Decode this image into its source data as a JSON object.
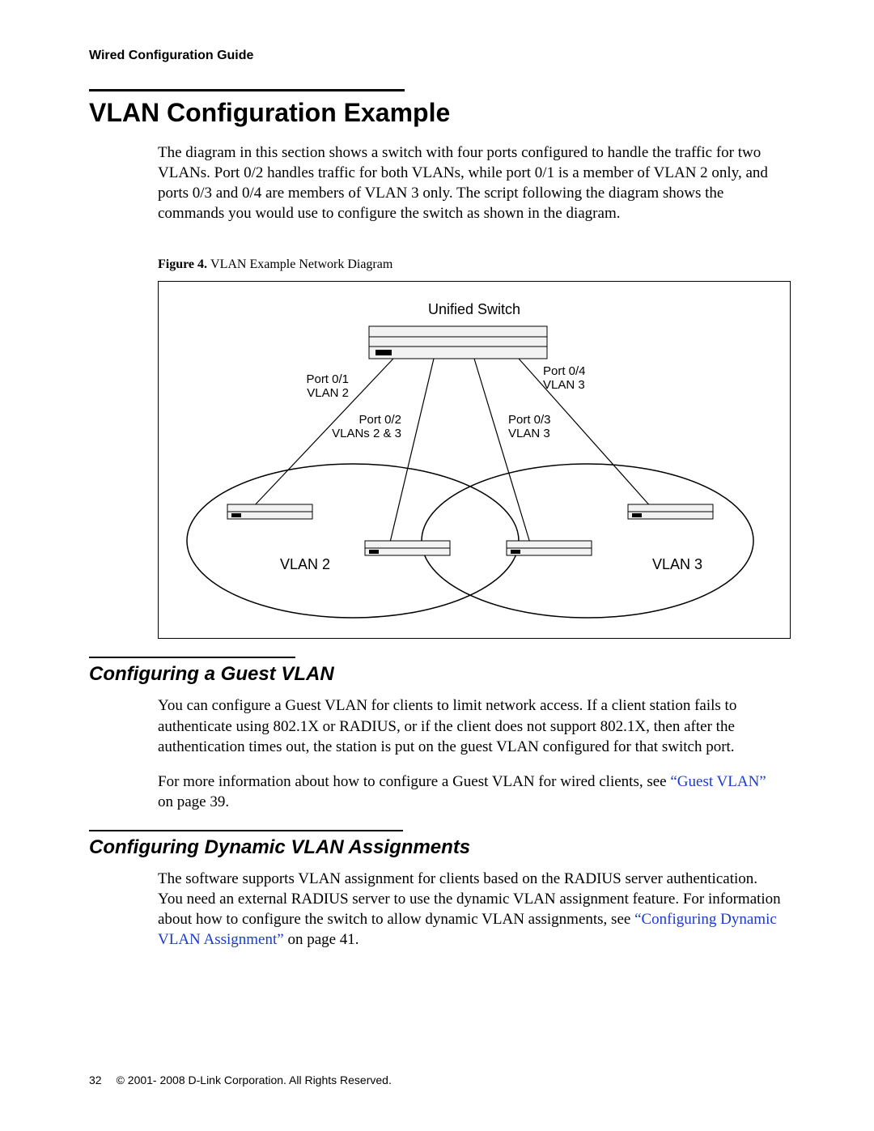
{
  "header": {
    "running_head": "Wired Configuration Guide"
  },
  "section": {
    "title": "VLAN Configuration Example",
    "intro": "The diagram in this section shows a switch with four ports configured to handle the traffic for two VLANs. Port 0/2 handles traffic for both VLANs, while port 0/1 is a member of VLAN 2 only, and ports 0/3 and 0/4 are members of VLAN 3 only. The script following the diagram shows the commands you would use to configure the switch as shown in the diagram."
  },
  "figure": {
    "label": "Figure 4. ",
    "caption": "VLAN Example Network Diagram",
    "top_label": "Unified Switch",
    "port1": {
      "name": "Port 0/1",
      "vlan": "VLAN 2"
    },
    "port2": {
      "name": "Port 0/2",
      "vlan": "VLANs 2 & 3"
    },
    "port3": {
      "name": "Port 0/3",
      "vlan": "VLAN 3"
    },
    "port4": {
      "name": "Port 0/4",
      "vlan": "VLAN 3"
    },
    "vlan_left": "VLAN 2",
    "vlan_right": "VLAN 3"
  },
  "sub1": {
    "title": "Configuring a Guest VLAN",
    "para1": "You can configure a Guest VLAN for clients to limit network access. If a client station fails to authenticate using 802.1X or RADIUS, or if the client does not support 802.1X, then after the authentication times out, the station is put on the guest VLAN configured for that switch port.",
    "para2_a": "For more information about how to configure a Guest VLAN for wired clients, see ",
    "para2_link": "“Guest VLAN”",
    "para2_b": " on page 39."
  },
  "sub2": {
    "title": "Configuring Dynamic VLAN Assignments",
    "para_a": "The software supports VLAN assignment for clients based on the RADIUS server authentication. You need an external RADIUS server to use the dynamic VLAN assignment feature. For information about how to configure the switch to allow dynamic VLAN assignments, see ",
    "para_link": "“Configuring Dynamic VLAN Assignment”",
    "para_b": " on page 41."
  },
  "footer": {
    "page": "32",
    "copyright": "© 2001- 2008 D-Link Corporation. All Rights Reserved."
  }
}
